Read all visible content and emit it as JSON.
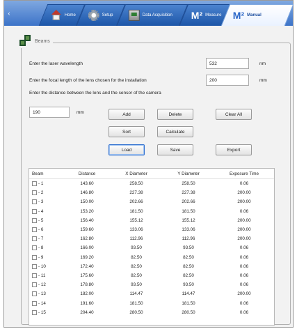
{
  "tabs": [
    {
      "label": "Home",
      "icon": "home-icon"
    },
    {
      "label": "Setup",
      "icon": "gear-icon"
    },
    {
      "label": "Data Acquisition",
      "icon": "daq-icon"
    },
    {
      "big": "M²",
      "label": "Measure"
    },
    {
      "big": "M²",
      "label": "Manual",
      "active": true
    }
  ],
  "group": {
    "title": "Beams",
    "icon": "beams-icon"
  },
  "form": {
    "wavelength_label": "Enter the laser wavelength",
    "wavelength_value": "532",
    "wavelength_unit": "nm",
    "focal_label": "Enter the focal length of the lens chosen for the installation",
    "focal_value": "200",
    "focal_unit": "mm",
    "distance_label": "Enter the distance between the lens and the sensor of the camera",
    "distance_value": "190",
    "distance_unit": "mm"
  },
  "buttons": {
    "add": "Add",
    "delete": "Delete",
    "clear_all": "Clear All",
    "sort": "Sort",
    "calculate": "Calculate",
    "load": "Load",
    "save": "Save",
    "export": "Export"
  },
  "table": {
    "headers": [
      "Beam",
      "Distance",
      "X Diameter",
      "Y Diameter",
      "Exposure Time"
    ],
    "rows": [
      [
        "- 1",
        "143.60",
        "258.50",
        "258.50",
        "0.06"
      ],
      [
        "- 2",
        "146.80",
        "227.38",
        "227.38",
        "200.00"
      ],
      [
        "- 3",
        "150.00",
        "202.66",
        "202.66",
        "200.00"
      ],
      [
        "- 4",
        "153.20",
        "181.50",
        "181.50",
        "0.06"
      ],
      [
        "- 5",
        "156.40",
        "155.12",
        "155.12",
        "200.00"
      ],
      [
        "- 6",
        "159.60",
        "133.06",
        "133.06",
        "200.00"
      ],
      [
        "- 7",
        "162.80",
        "112.96",
        "112.96",
        "200.00"
      ],
      [
        "- 8",
        "166.00",
        "93.50",
        "93.50",
        "0.06"
      ],
      [
        "- 9",
        "169.20",
        "82.50",
        "82.50",
        "0.06"
      ],
      [
        "- 10",
        "172.40",
        "82.50",
        "82.50",
        "0.06"
      ],
      [
        "- 11",
        "175.60",
        "82.50",
        "82.50",
        "0.06"
      ],
      [
        "- 12",
        "178.80",
        "93.50",
        "93.50",
        "0.06"
      ],
      [
        "- 13",
        "182.00",
        "114.47",
        "114.47",
        "200.00"
      ],
      [
        "- 14",
        "191.60",
        "181.50",
        "181.50",
        "0.06"
      ],
      [
        "- 15",
        "204.40",
        "280.50",
        "280.50",
        "0.06"
      ]
    ]
  }
}
